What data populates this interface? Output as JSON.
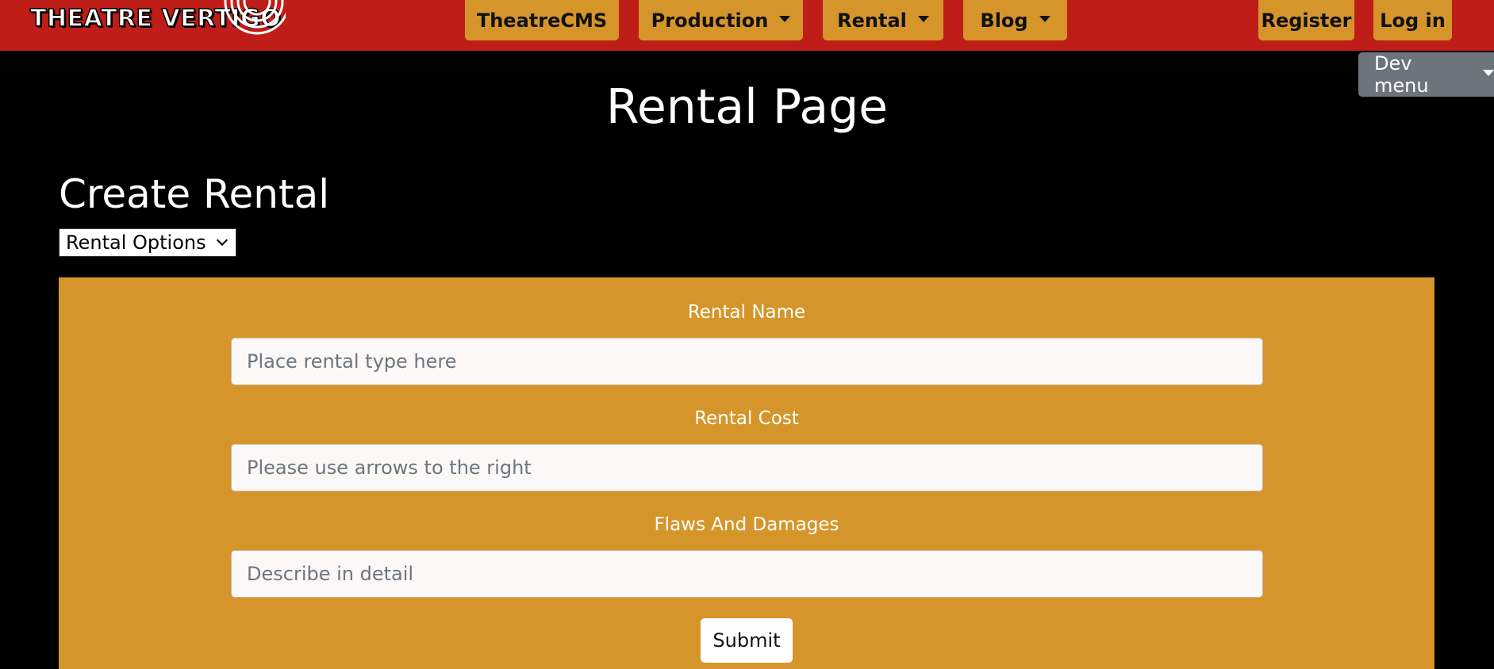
{
  "brand": {
    "name": "THEATRE VERTIGO"
  },
  "nav": {
    "theatrecms": "TheatreCMS",
    "production": "Production",
    "rental": "Rental",
    "blog": "Blog",
    "register": "Register",
    "login": "Log in"
  },
  "dev_menu": {
    "label": "Dev menu"
  },
  "page": {
    "title": "Rental Page",
    "section_title": "Create Rental",
    "rental_options_selected": "Rental Options"
  },
  "form": {
    "rental_name_label": "Rental Name",
    "rental_name_placeholder": "Place rental type here",
    "rental_cost_label": "Rental Cost",
    "rental_cost_placeholder": "Please use arrows to the right",
    "flaws_label": "Flaws And Damages",
    "flaws_placeholder": "Describe in detail",
    "submit_label": "Submit"
  },
  "colors": {
    "navbar": "#be1e17",
    "accent": "#d5952a",
    "dev_menu": "#6c757d",
    "background": "#000000"
  }
}
